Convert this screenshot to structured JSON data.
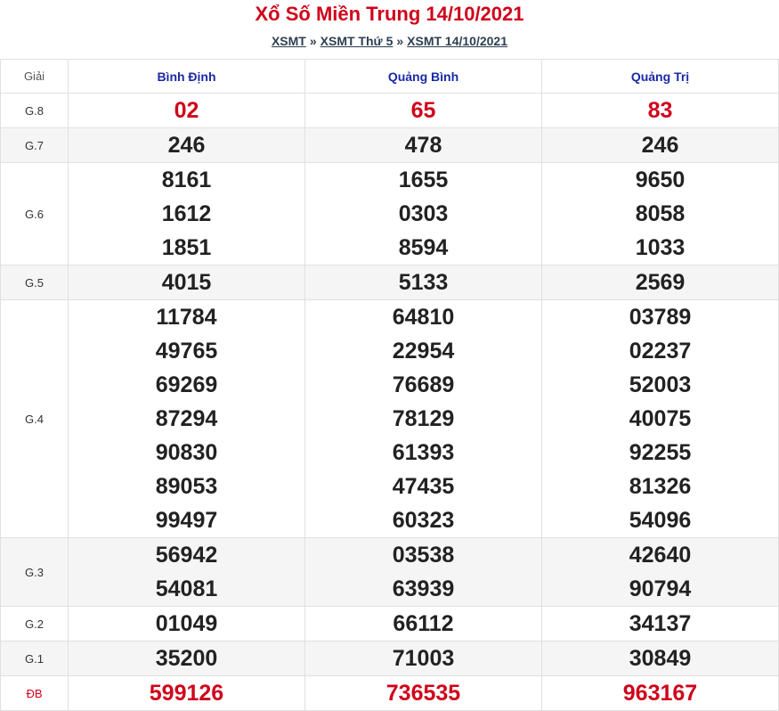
{
  "header": {
    "title": "Xổ Số Miền Trung 14/10/2021",
    "crumbs": [
      "XSMT",
      "XSMT Thứ 5",
      "XSMT 14/10/2021"
    ],
    "separator": "»"
  },
  "table": {
    "col_label": "Giải",
    "provinces": [
      "Bình Định",
      "Quảng Bình",
      "Quảng Trị"
    ],
    "rows": [
      {
        "label": "G.8",
        "values": [
          [
            "02"
          ],
          [
            "65"
          ],
          [
            "83"
          ]
        ]
      },
      {
        "label": "G.7",
        "values": [
          [
            "246"
          ],
          [
            "478"
          ],
          [
            "246"
          ]
        ]
      },
      {
        "label": "G.6",
        "values": [
          [
            "8161",
            "1612",
            "1851"
          ],
          [
            "1655",
            "0303",
            "8594"
          ],
          [
            "9650",
            "8058",
            "1033"
          ]
        ]
      },
      {
        "label": "G.5",
        "values": [
          [
            "4015"
          ],
          [
            "5133"
          ],
          [
            "2569"
          ]
        ]
      },
      {
        "label": "G.4",
        "values": [
          [
            "11784",
            "49765",
            "69269",
            "87294",
            "90830",
            "89053",
            "99497"
          ],
          [
            "64810",
            "22954",
            "76689",
            "78129",
            "61393",
            "47435",
            "60323"
          ],
          [
            "03789",
            "02237",
            "52003",
            "40075",
            "92255",
            "81326",
            "54096"
          ]
        ]
      },
      {
        "label": "G.3",
        "values": [
          [
            "56942",
            "54081"
          ],
          [
            "03538",
            "63939"
          ],
          [
            "42640",
            "90794"
          ]
        ]
      },
      {
        "label": "G.2",
        "values": [
          [
            "01049"
          ],
          [
            "66112"
          ],
          [
            "34137"
          ]
        ]
      },
      {
        "label": "G.1",
        "values": [
          [
            "35200"
          ],
          [
            "71003"
          ],
          [
            "30849"
          ]
        ]
      },
      {
        "label": "ĐB",
        "values": [
          [
            "599126"
          ],
          [
            "736535"
          ],
          [
            "963167"
          ]
        ]
      }
    ]
  },
  "colors": {
    "accent_red": "#d0021b",
    "province_blue": "#1a2aa6",
    "alt_row": "#f5f5f5"
  }
}
